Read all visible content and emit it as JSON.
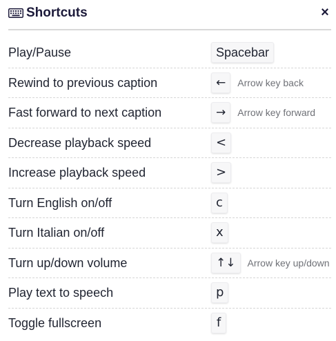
{
  "header": {
    "title": "Shortcuts",
    "close_symbol": "×",
    "icon": "keyboard-icon"
  },
  "shortcuts": [
    {
      "label": "Play/Pause",
      "key": "Spacebar",
      "hint": ""
    },
    {
      "label": "Rewind to previous caption",
      "key": "←",
      "hint": "Arrow key back"
    },
    {
      "label": "Fast forward to next caption",
      "key": "→",
      "hint": "Arrow key forward"
    },
    {
      "label": "Decrease playback speed",
      "key": "<",
      "hint": ""
    },
    {
      "label": "Increase playback speed",
      "key": ">",
      "hint": ""
    },
    {
      "label": "Turn English on/off",
      "key": "c",
      "hint": ""
    },
    {
      "label": "Turn Italian on/off",
      "key": "x",
      "hint": ""
    },
    {
      "label": "Turn up/down volume",
      "key": "↑↓",
      "hint": "Arrow key up/down"
    },
    {
      "label": "Play text to speech",
      "key": "p",
      "hint": ""
    },
    {
      "label": "Toggle fullscreen",
      "key": "f",
      "hint": ""
    }
  ]
}
